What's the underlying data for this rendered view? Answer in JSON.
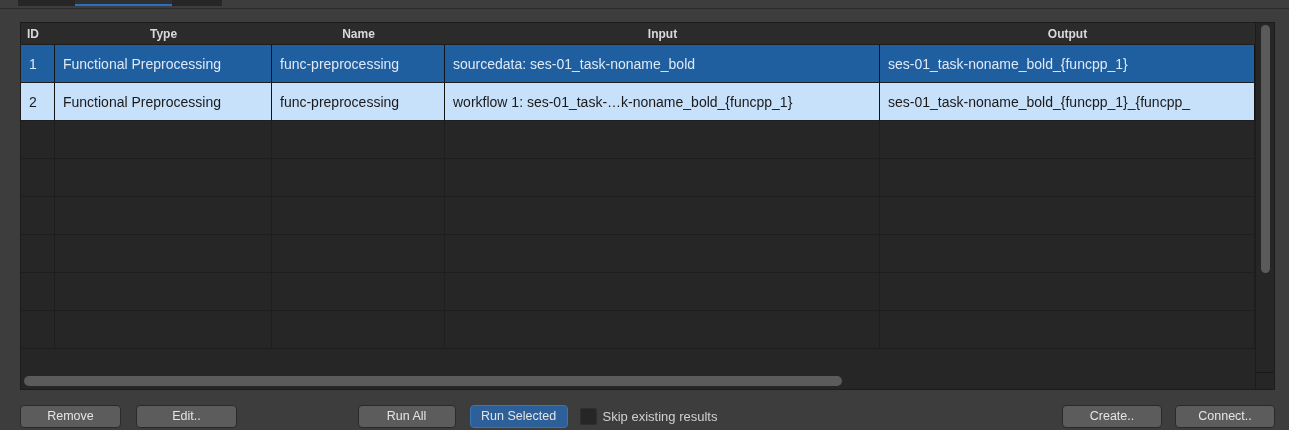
{
  "tabs": [
    {
      "selected": false
    },
    {
      "selected": true
    },
    {
      "selected": false
    }
  ],
  "table": {
    "columns": [
      "ID",
      "Type",
      "Name",
      "Input",
      "Output"
    ],
    "rows": [
      {
        "cells": [
          "1",
          "Functional Preprocessing",
          "func-preprocessing",
          "sourcedata: ses-01_task-noname_bold",
          "ses-01_task-noname_bold_{funcpp_1}"
        ],
        "selected": true,
        "current": true
      },
      {
        "cells": [
          "2",
          "Functional Preprocessing",
          "func-preprocessing",
          "workflow 1: ses-01_task-…k-noname_bold_{funcpp_1}",
          "ses-01_task-noname_bold_{funcpp_1}_{funcpp_"
        ],
        "selected": true,
        "current": false
      }
    ]
  },
  "left_buttons": [
    {
      "label": "Remove",
      "default": false
    },
    {
      "label": "Edit..",
      "default": false
    }
  ],
  "center_buttons": [
    {
      "label": "Run All",
      "default": false
    },
    {
      "label": "Run Selected",
      "default": true
    }
  ],
  "skip_checkbox": {
    "label": "Skip existing results",
    "checked": false
  },
  "right_buttons": [
    {
      "label": "Create..",
      "default": false
    },
    {
      "label": "Connect..",
      "default": false
    }
  ]
}
